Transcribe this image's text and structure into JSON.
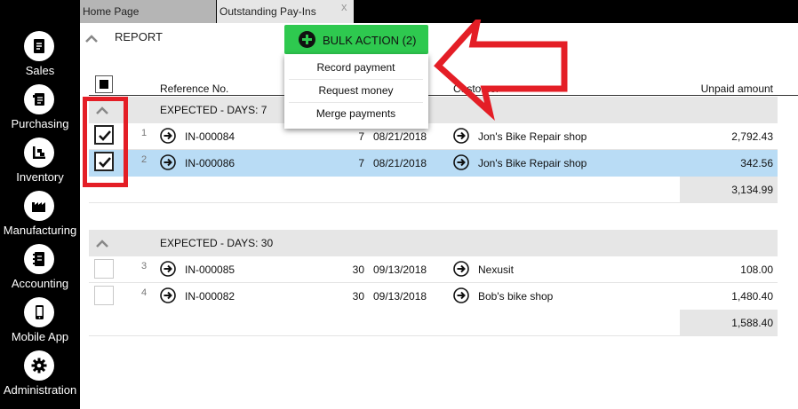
{
  "sidebar": {
    "items": [
      {
        "label": "Sales",
        "icon": "sales-icon"
      },
      {
        "label": "Purchasing",
        "icon": "purchasing-icon"
      },
      {
        "label": "Inventory",
        "icon": "inventory-icon"
      },
      {
        "label": "Manufacturing",
        "icon": "manufacturing-icon"
      },
      {
        "label": "Accounting",
        "icon": "accounting-icon"
      },
      {
        "label": "Mobile App",
        "icon": "mobile-app-icon"
      },
      {
        "label": "Administration",
        "icon": "gear-icon"
      }
    ]
  },
  "tabs": [
    {
      "label": "Home Page",
      "active": false
    },
    {
      "label": "Outstanding Pay-Ins",
      "active": true,
      "close": "x"
    }
  ],
  "report": {
    "label": "REPORT"
  },
  "bulk_action": {
    "label": "BULK ACTION (2)",
    "menu": [
      "Record payment",
      "Request money",
      "Merge payments"
    ]
  },
  "columns": {
    "reference": "Reference No.",
    "customer": "Customer",
    "unpaid": "Unpaid amount"
  },
  "groups": [
    {
      "label": "EXPECTED - DAYS: 7",
      "rows": [
        {
          "num": "1",
          "ref": "IN-000084",
          "days": "7",
          "date": "08/21/2018",
          "customer": "Jon's Bike Repair shop",
          "amount": "2,792.43",
          "checked": true,
          "selected": false
        },
        {
          "num": "2",
          "ref": "IN-000086",
          "days": "7",
          "date": "08/21/2018",
          "customer": "Jon's Bike Repair shop",
          "amount": "342.56",
          "checked": true,
          "selected": true
        }
      ],
      "subtotal": "3,134.99"
    },
    {
      "label": "EXPECTED - DAYS: 30",
      "rows": [
        {
          "num": "3",
          "ref": "IN-000085",
          "days": "30",
          "date": "09/13/2018",
          "customer": "Nexusit",
          "amount": "108.00",
          "checked": false,
          "selected": false
        },
        {
          "num": "4",
          "ref": "IN-000082",
          "days": "30",
          "date": "09/13/2018",
          "customer": "Bob's bike shop",
          "amount": "1,480.40",
          "checked": false,
          "selected": false
        }
      ],
      "subtotal": "1,588.40"
    }
  ],
  "colors": {
    "accent_green": "#2ec94f",
    "selected_row": "#b9dcf5",
    "annotation_red": "#e41e26",
    "group_band": "#e6e6e6"
  }
}
